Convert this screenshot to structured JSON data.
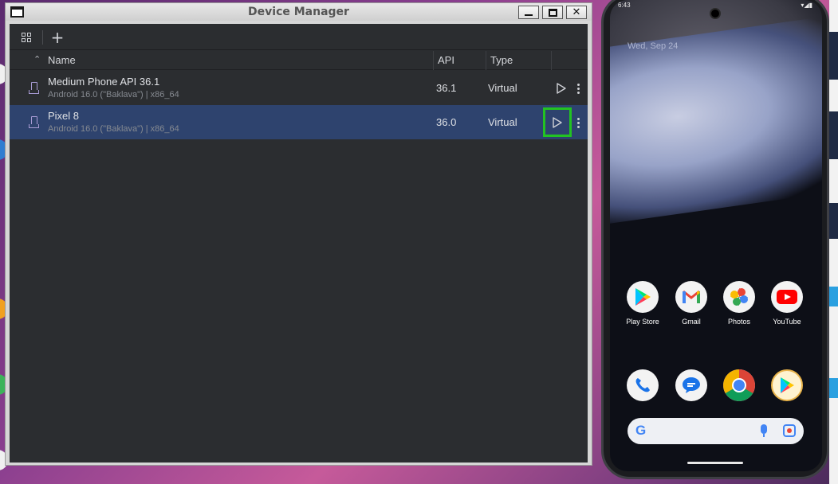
{
  "window": {
    "title": "Device Manager"
  },
  "toolbar": {
    "add_label": "+"
  },
  "table": {
    "columns": {
      "name": "Name",
      "api": "API",
      "type": "Type"
    },
    "rows": [
      {
        "name": "Medium Phone API 36.1",
        "subtitle": "Android 16.0 (\"Baklava\") | x86_64",
        "api": "36.1",
        "type": "Virtual",
        "selected": false
      },
      {
        "name": "Pixel 8",
        "subtitle": "Android 16.0 (\"Baklava\") | x86_64",
        "api": "36.0",
        "type": "Virtual",
        "selected": true
      }
    ]
  },
  "phone": {
    "status_time": "6:43",
    "date": "Wed, Sep 24",
    "apps_row1": [
      {
        "label": "Play Store",
        "icon": "play-store-icon"
      },
      {
        "label": "Gmail",
        "icon": "gmail-icon"
      },
      {
        "label": "Photos",
        "icon": "photos-icon"
      },
      {
        "label": "YouTube",
        "icon": "youtube-icon"
      }
    ],
    "dock": [
      {
        "icon": "phone-app-icon"
      },
      {
        "icon": "messages-icon"
      },
      {
        "icon": "chrome-icon"
      },
      {
        "icon": "play-games-icon"
      }
    ],
    "search_letter": "G"
  },
  "colors": {
    "highlight_box": "#22c322",
    "selected_row": "#2e436e",
    "panel_bg": "#2b2d30"
  }
}
